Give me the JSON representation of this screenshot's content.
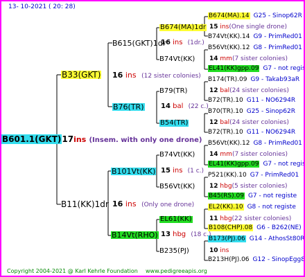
{
  "header": {
    "date": "13- 10-2021 ( 20: 28)"
  },
  "root": {
    "id": "B601.1(GKT)",
    "ins_count": "17",
    "ins_label": "ins",
    "note": "(Insem. with only one drone)"
  },
  "gen2": [
    {
      "id": "B33(GKT)",
      "count": "16",
      "label": "ins",
      "note": "(12 sister colonies)"
    },
    {
      "id": "B11(KK)1dr",
      "count": "16",
      "label": "ins",
      "note": "(Only one drone)"
    }
  ],
  "gen3": [
    {
      "id": "B615(GKT)1dr",
      "count": "16",
      "label": "ins",
      "note": "(1dr.)"
    },
    {
      "id": "B76(TR)",
      "count": "14",
      "label": "bal",
      "note": "(22 c.)"
    },
    {
      "id": "B101Vt(KK)",
      "count": "15",
      "label": "ins",
      "note": "(1 c.)"
    },
    {
      "id": "B14Vt(RHO)",
      "count": "13",
      "label": "hbg",
      "note": "(18 c.)"
    }
  ],
  "gen4": [
    {
      "id": "B674(MA)1dr",
      "count": "15",
      "label": "ins",
      "note": "(One single drone)"
    },
    {
      "id": "B74Vt(KK)",
      "count": "14",
      "label": "mm",
      "note": "(7 sister colonies)"
    },
    {
      "id": "B79(TR)",
      "count": "12",
      "label": "bal",
      "note": "(24 sister colonies)"
    },
    {
      "id": "B54(TR)",
      "count": "12",
      "label": "bal",
      "note": "(24 sister colonies)"
    },
    {
      "id": "B74Vt(KK)",
      "count": "14",
      "label": "mm",
      "note": "(7 sister colonies)"
    },
    {
      "id": "B56Vt(KK)",
      "count": "12",
      "label": "hbg",
      "note": "(5 sister colonies)"
    },
    {
      "id": "EL61(KK)",
      "count": "11",
      "label": "hbg",
      "note": "(22 sister colonies)"
    },
    {
      "id": "B235(PJ)",
      "count": "10",
      "label": "ins",
      "note": ""
    }
  ],
  "gen5": [
    {
      "id": "B674(MA).14",
      "code": "G25 - Sinop62R",
      "hl": "y"
    },
    {
      "id": "B74Vt(KK).14",
      "code": "G9 - PrimRed01",
      "hl": ""
    },
    {
      "id": "B56Vt(KK).12",
      "code": "G8 - PrimRed01",
      "hl": ""
    },
    {
      "id": "EL41(KK)gpp.09",
      "code": "G7 - not registe",
      "hl": "g"
    },
    {
      "id": "B174(TR).09",
      "code": "G9 - Takab93aR",
      "hl": ""
    },
    {
      "id": "B72(TR).10",
      "code": "G11 - NO6294R",
      "hl": ""
    },
    {
      "id": "B70(TR).10",
      "code": "G25 - Sinop62R",
      "hl": ""
    },
    {
      "id": "B72(TR).10",
      "code": "G11 - NO6294R",
      "hl": ""
    },
    {
      "id": "B56Vt(KK).12",
      "code": "G8 - PrimRed01",
      "hl": ""
    },
    {
      "id": "EL41(KK)gpp.09",
      "code": "G7 - not registe",
      "hl": "g"
    },
    {
      "id": "P521(KK).10",
      "code": "G7 - PrimRed01",
      "hl": ""
    },
    {
      "id": "B45(RS).09",
      "code": "G7 - not registe",
      "hl": "g"
    },
    {
      "id": "EL2(KK).10",
      "code": "G8 - not registe",
      "hl": "y"
    },
    {
      "id": "B108(CHP).08",
      "code": "G6 - B262(NE)",
      "hl": "y"
    },
    {
      "id": "B173(PJ).06",
      "code": "G14 - AthosSt80R",
      "hl": "c"
    },
    {
      "id": "B213H(PJ).06",
      "code": "G12 - SinopEgg86R",
      "hl": ""
    }
  ],
  "footer": {
    "copyright": "Copyright 2004-2021 @ Karl Kehrle Foundation",
    "url": "www.pedigreeapis.org"
  }
}
